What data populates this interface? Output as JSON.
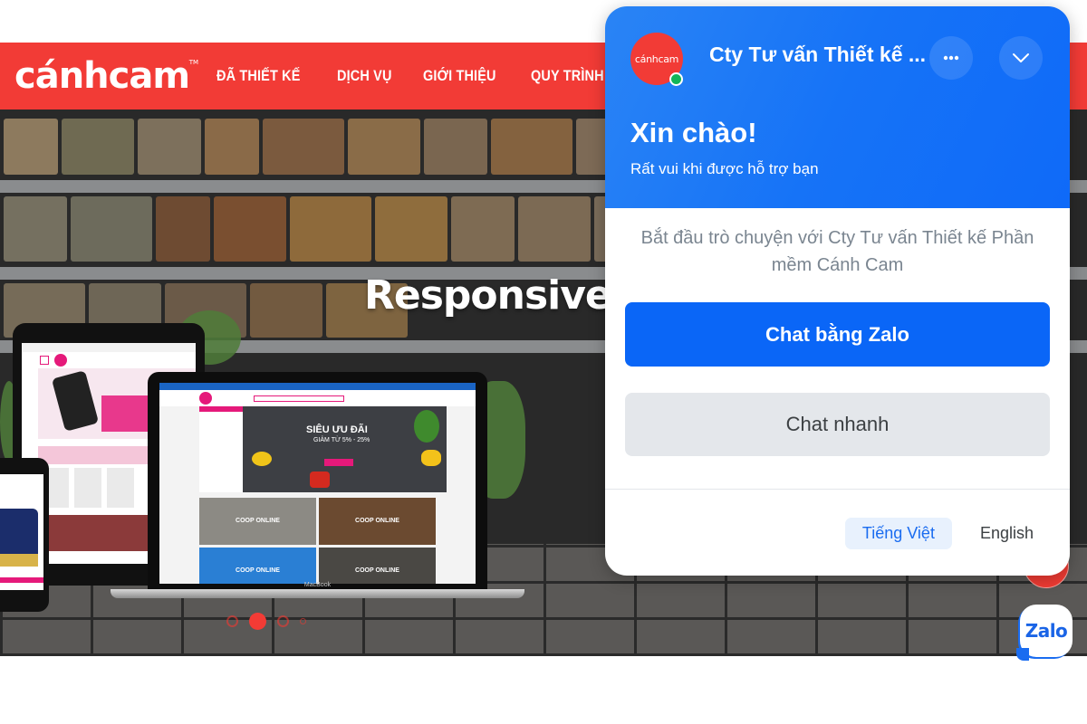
{
  "site": {
    "logo_text": "cánhcam",
    "logo_tm": "TM",
    "nav": [
      {
        "label": "ĐÃ THIẾT KẾ"
      },
      {
        "label": "DỊCH VỤ"
      },
      {
        "label": "GIỚI THIỆU"
      },
      {
        "label": "QUY TRÌNH"
      }
    ],
    "brand_color": "#f23b36"
  },
  "hero": {
    "title": "Responsive",
    "laptop_label": "MacBook",
    "laptop_banner_title": "SIÊU ƯU ĐÃI",
    "laptop_banner_sub": "GIẢM TỪ 5% - 25%",
    "tile_label": "COOP ONLINE",
    "slider": {
      "total_dots": 4,
      "active_index": 1
    }
  },
  "chat_widget": {
    "avatar_text": "cánhcam",
    "online_status": "online",
    "org_name": "Cty Tư vấn Thiết kế ...",
    "more_icon": "more-horizontal-icon",
    "collapse_icon": "chevron-down-icon",
    "greeting": "Xin chào!",
    "greeting_sub": "Rất vui khi được hỗ trợ bạn",
    "intro_line1": "Bắt đầu trò chuyện với Cty Tư vấn Thiết kế Phần",
    "intro_line2": "mềm Cánh Cam",
    "primary_button": "Chat bằng Zalo",
    "secondary_button": "Chat nhanh",
    "languages": [
      {
        "label": "Tiếng Việt",
        "active": true
      },
      {
        "label": "English",
        "active": false
      }
    ],
    "accent_color": "#0a66f7"
  },
  "floating": {
    "zalo_label": "Zalo"
  }
}
